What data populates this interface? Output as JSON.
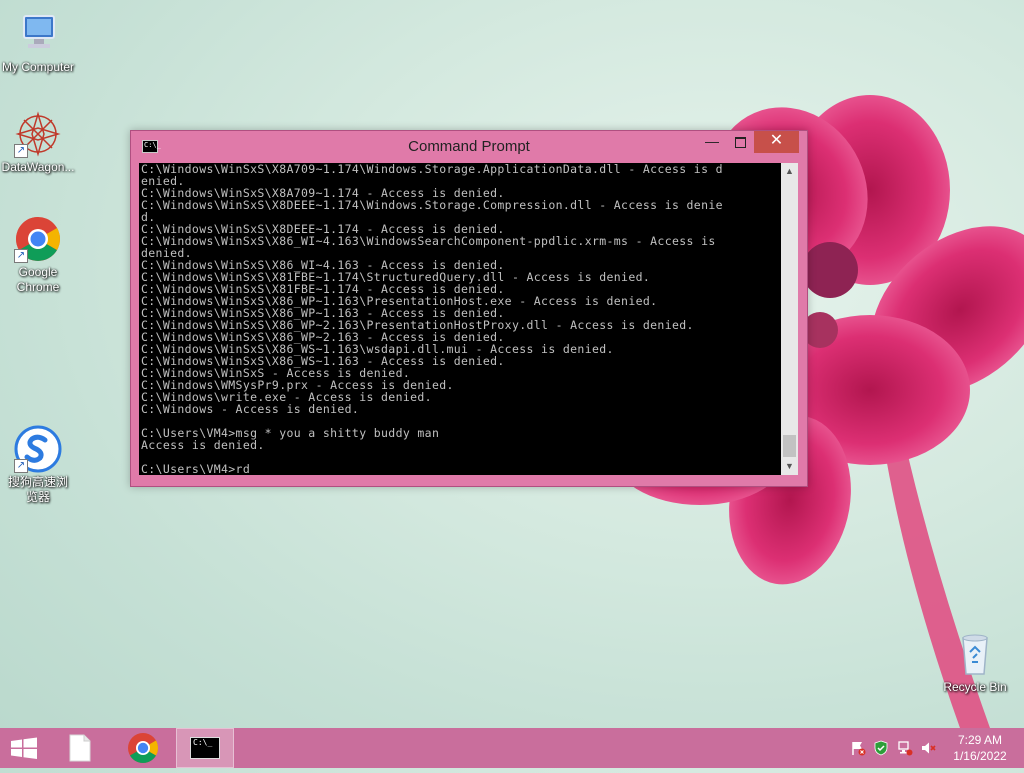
{
  "desktop": {
    "icons": [
      {
        "label": "My Computer"
      },
      {
        "label": "DataWagon..."
      },
      {
        "label": "Google\nChrome"
      },
      {
        "label": "搜狗高速浏\n览器"
      },
      {
        "label": "Recycle Bin"
      }
    ]
  },
  "window": {
    "title": "Command Prompt",
    "icon_text": "C:\\_",
    "minimize": "—",
    "close": "✕",
    "console_lines": [
      "C:\\Windows\\WinSxS\\X8A709~1.174\\Windows.Storage.ApplicationData.dll - Access is d",
      "enied.",
      "C:\\Windows\\WinSxS\\X8A709~1.174 - Access is denied.",
      "C:\\Windows\\WinSxS\\X8DEEE~1.174\\Windows.Storage.Compression.dll - Access is denie",
      "d.",
      "C:\\Windows\\WinSxS\\X8DEEE~1.174 - Access is denied.",
      "C:\\Windows\\WinSxS\\X86_WI~4.163\\WindowsSearchComponent-ppdlic.xrm-ms - Access is",
      "denied.",
      "C:\\Windows\\WinSxS\\X86_WI~4.163 - Access is denied.",
      "C:\\Windows\\WinSxS\\X81FBE~1.174\\StructuredQuery.dll - Access is denied.",
      "C:\\Windows\\WinSxS\\X81FBE~1.174 - Access is denied.",
      "C:\\Windows\\WinSxS\\X86_WP~1.163\\PresentationHost.exe - Access is denied.",
      "C:\\Windows\\WinSxS\\X86_WP~1.163 - Access is denied.",
      "C:\\Windows\\WinSxS\\X86_WP~2.163\\PresentationHostProxy.dll - Access is denied.",
      "C:\\Windows\\WinSxS\\X86_WP~2.163 - Access is denied.",
      "C:\\Windows\\WinSxS\\X86_WS~1.163\\wsdapi.dll.mui - Access is denied.",
      "C:\\Windows\\WinSxS\\X86_WS~1.163 - Access is denied.",
      "C:\\Windows\\WinSxS - Access is denied.",
      "C:\\Windows\\WMSysPr9.prx - Access is denied.",
      "C:\\Windows\\write.exe - Access is denied.",
      "C:\\Windows - Access is denied.",
      "",
      "C:\\Users\\VM4>msg * you a shitty buddy man",
      "Access is denied.",
      "",
      "C:\\Users\\VM4>rd"
    ]
  },
  "taskbar": {
    "cmd_icon_text": "C:\\_",
    "clock_time": "7:29 AM",
    "clock_date": "1/16/2022"
  },
  "colors": {
    "window_frame": "#e07aa9",
    "close_button": "#c7504a",
    "taskbar": "#c96e9c",
    "console_bg": "#000000",
    "console_fg": "#c0c0c0"
  },
  "icons": [
    "my-computer-icon",
    "datawagon-icon",
    "chrome-icon",
    "sogou-browser-icon",
    "recycle-bin-icon",
    "windows-logo-icon",
    "file-explorer-icon",
    "cmd-icon",
    "action-center-flag-icon",
    "security-shield-icon",
    "network-icon",
    "volume-muted-icon"
  ]
}
